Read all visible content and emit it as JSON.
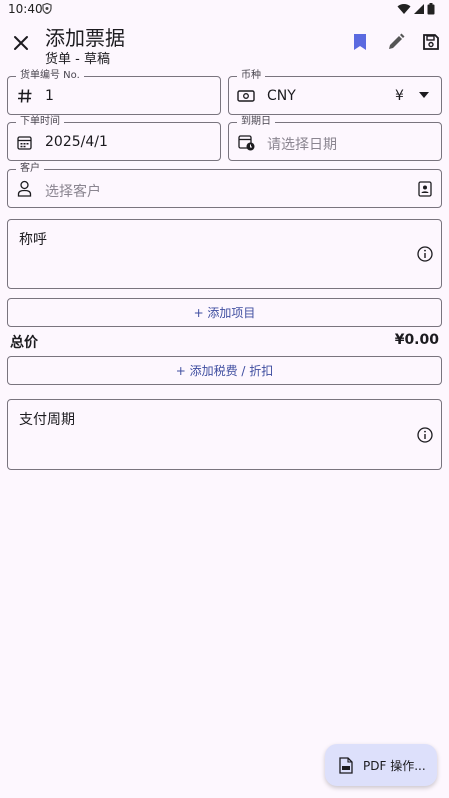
{
  "status": {
    "time": "10:40"
  },
  "appbar": {
    "title": "添加票据",
    "subtitle": "货单 - 草稿"
  },
  "fields": {
    "number": {
      "label": "货单编号 No.",
      "value": "1"
    },
    "currency": {
      "label": "币种",
      "value": "CNY",
      "symbol": "¥"
    },
    "order_date": {
      "label": "下单时间",
      "value": "2025/4/1"
    },
    "due_date": {
      "label": "到期日",
      "placeholder": "请选择日期"
    },
    "client": {
      "label": "客户",
      "placeholder": "选择客户"
    },
    "greeting": {
      "label": "称呼"
    },
    "payment_terms": {
      "label": "支付周期"
    }
  },
  "buttons": {
    "add_item": "+ 添加项目",
    "add_tax": "+ 添加税费 / 折扣",
    "pdf": "PDF 操作..."
  },
  "total": {
    "label": "总价",
    "value": "¥0.00"
  },
  "colors": {
    "accent": "#5b6ae0",
    "background": "#fdf7fe",
    "fab": "#dde0fb"
  }
}
